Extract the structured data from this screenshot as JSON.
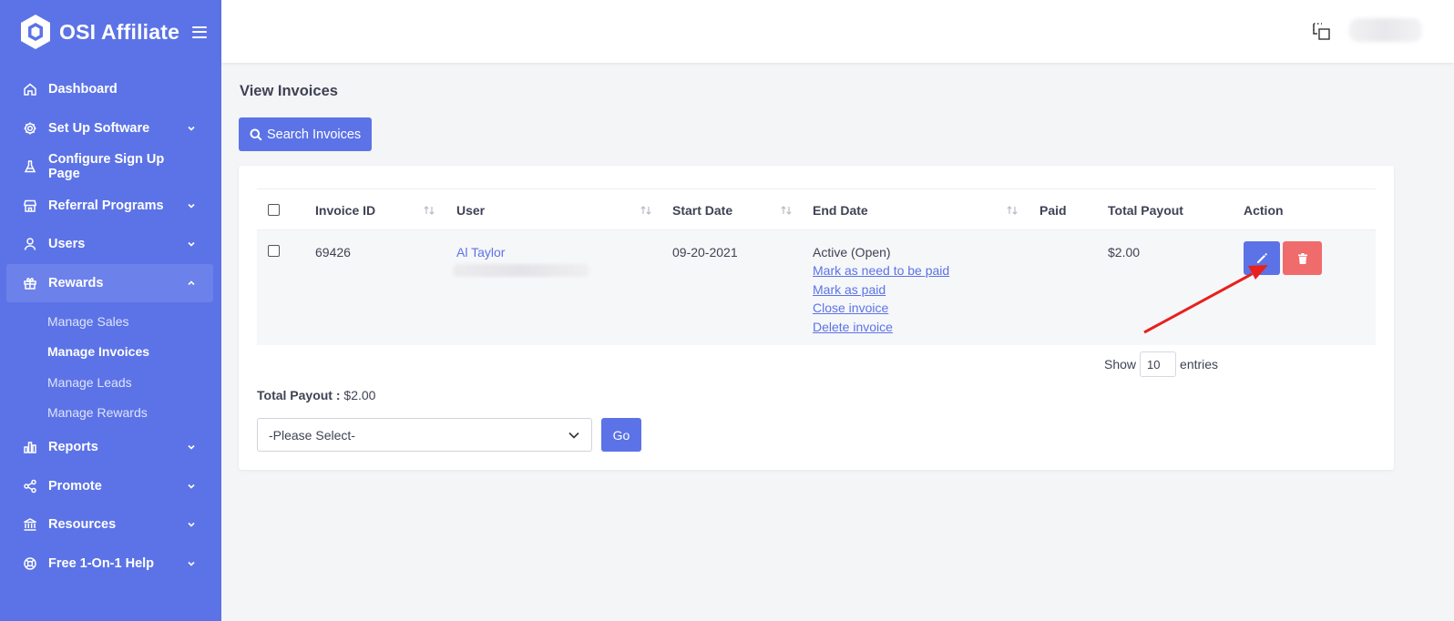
{
  "brand": {
    "name": "OSI Affiliate"
  },
  "sidebar": {
    "items": [
      {
        "label": "Dashboard",
        "icon": "home-icon",
        "chevron": false
      },
      {
        "label": "Set Up Software",
        "icon": "gear-icon",
        "chevron": true
      },
      {
        "label": "Configure Sign Up Page",
        "icon": "flask-icon",
        "chevron": false
      },
      {
        "label": "Referral Programs",
        "icon": "store-icon",
        "chevron": true
      },
      {
        "label": "Users",
        "icon": "user-icon",
        "chevron": true
      },
      {
        "label": "Rewards",
        "icon": "gift-icon",
        "chevron": true,
        "expanded": true
      }
    ],
    "rewards_sub": [
      "Manage Sales",
      "Manage Invoices",
      "Manage Leads",
      "Manage Rewards"
    ],
    "items_after": [
      {
        "label": "Reports",
        "icon": "bar-chart-icon"
      },
      {
        "label": "Promote",
        "icon": "share-icon"
      },
      {
        "label": "Resources",
        "icon": "bank-icon"
      },
      {
        "label": "Free 1-On-1 Help",
        "icon": "lifebuoy-icon"
      }
    ]
  },
  "main": {
    "title": "View Invoices",
    "search_button": "Search Invoices",
    "table": {
      "columns": [
        "Invoice ID",
        "User",
        "Start Date",
        "End Date",
        "Paid",
        "Total Payout",
        "Action"
      ],
      "rows": [
        {
          "invoice_id": "69426",
          "user": "Al Taylor",
          "start_date": "09-20-2021",
          "end_status": "Active (Open)",
          "end_links": [
            "Mark as need to be paid",
            "Mark as paid",
            "Close invoice",
            "Delete invoice"
          ],
          "paid": "",
          "total_payout": "$2.00"
        }
      ]
    },
    "show_label": "Show",
    "entries_value": "10",
    "entries_label": "entries",
    "total_payout_label": "Total Payout :",
    "total_payout_value": "$2.00",
    "select_placeholder": "-Please Select-",
    "go_button": "Go"
  },
  "colors": {
    "primary": "#5c73e7",
    "danger": "#f06b6b",
    "arrow": "#e8211f"
  }
}
